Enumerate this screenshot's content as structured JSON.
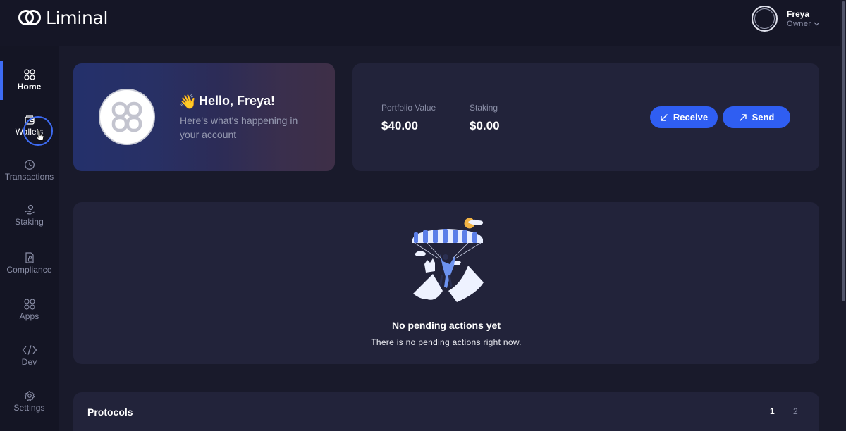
{
  "app": {
    "name": "Liminal"
  },
  "user": {
    "name": "Freya",
    "role": "Owner"
  },
  "sidebar": {
    "items": [
      {
        "label": "Home",
        "icon": "grid-icon",
        "active": true
      },
      {
        "label": "Wallets",
        "icon": "wallet-icon",
        "active": false
      },
      {
        "label": "Transactions",
        "icon": "clock-icon",
        "active": false
      },
      {
        "label": "Staking",
        "icon": "staking-hand-icon",
        "active": false
      },
      {
        "label": "Compliance",
        "icon": "compliance-lock-icon",
        "active": false
      },
      {
        "label": "Apps",
        "icon": "apps-grid-icon",
        "active": false
      },
      {
        "label": "Dev",
        "icon": "code-icon",
        "active": false
      },
      {
        "label": "Settings",
        "icon": "gear-icon",
        "active": false
      }
    ]
  },
  "hello": {
    "emoji": "👋",
    "title": "Hello, Freya!",
    "subtitle": "Here's what's happening in your account"
  },
  "portfolio": {
    "value_label": "Portfolio Value",
    "value": "$40.00",
    "staking_label": "Staking",
    "staking_value": "$0.00",
    "receive_label": "Receive",
    "send_label": "Send"
  },
  "pending": {
    "title": "No pending actions yet",
    "subtitle": "There is no pending actions right now."
  },
  "protocols": {
    "title": "Protocols",
    "pages": [
      "1",
      "2"
    ],
    "current_page": "1"
  },
  "colors": {
    "accent": "#2f5ef2",
    "background": "#191a2b",
    "sidebar": "#141524",
    "card": "#22233a"
  }
}
